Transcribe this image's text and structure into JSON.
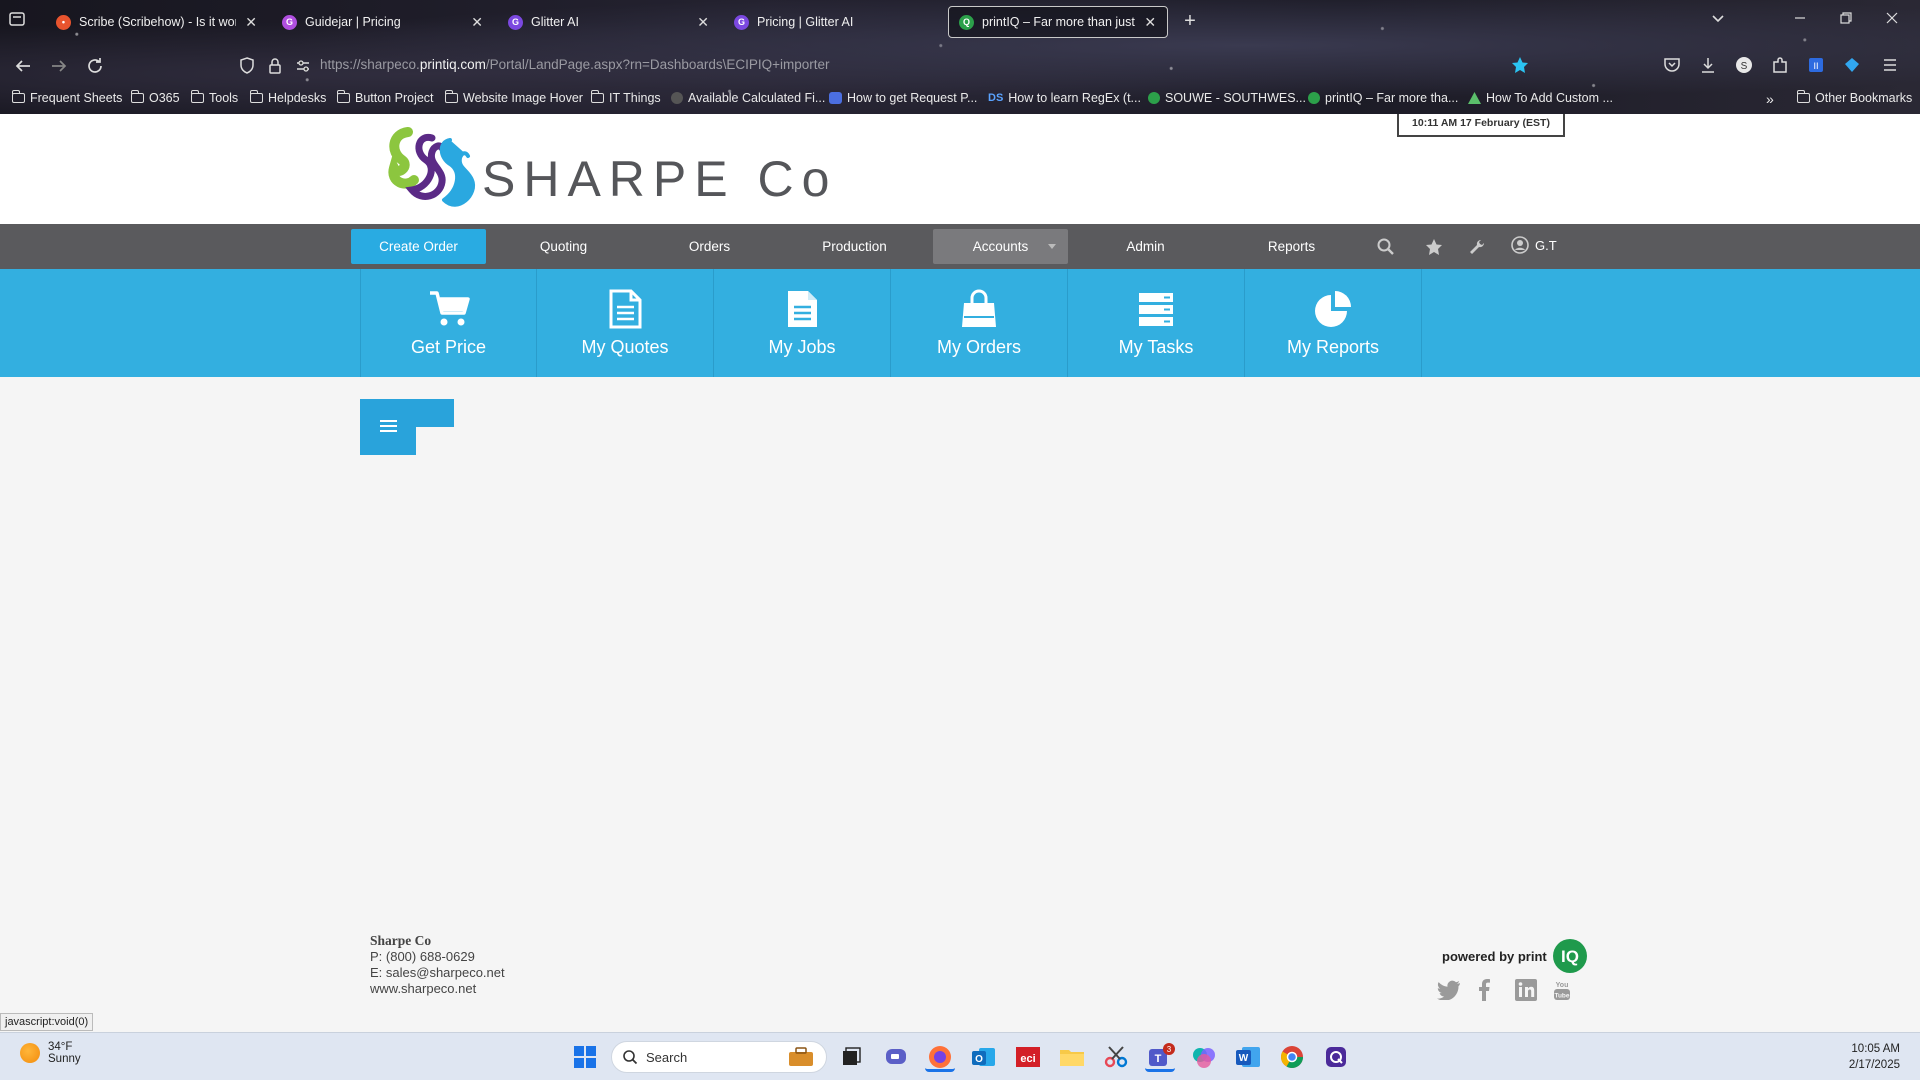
{
  "browser": {
    "tabs": [
      {
        "title": "Scribe (Scribehow) - Is it worth",
        "close": "✕",
        "icon_color": "#e8542e"
      },
      {
        "title": "Guidejar | Pricing",
        "close": "✕",
        "icon_color": "#b04fe0"
      },
      {
        "title": "Glitter AI",
        "close": "✕",
        "icon_color": "#8a4fe6"
      },
      {
        "title": "Pricing | Glitter AI",
        "close": "",
        "icon_color": "#8a4fe6"
      },
      {
        "title": "printIQ – Far more than just an",
        "close": "✕",
        "icon_color": "#2ca04a"
      }
    ],
    "new_tab": "+",
    "url": {
      "prefix": "https://sharpeco.",
      "host": "printiq.com",
      "path": "/Portal/LandPage.aspx?rn=Dashboards\\ECIPIQ+importer"
    },
    "bookmarks": [
      {
        "label": "Frequent Sheets",
        "icon": "folder-icon"
      },
      {
        "label": "O365",
        "icon": "folder-icon"
      },
      {
        "label": "Tools",
        "icon": "folder-icon"
      },
      {
        "label": "Helpdesks",
        "icon": "folder-icon"
      },
      {
        "label": "Button Project",
        "icon": "folder-icon"
      },
      {
        "label": "Website Image Hover",
        "icon": "folder-icon"
      },
      {
        "label": "IT Things",
        "icon": "folder-icon"
      },
      {
        "label": "Available Calculated Fi...",
        "icon": "globe-icon"
      },
      {
        "label": "How to get Request P...",
        "icon": "people-icon"
      },
      {
        "label": "How to learn RegEx (t...",
        "icon": "ds-icon"
      },
      {
        "label": "SOUWE - SOUTHWES...",
        "icon": "printiq-icon"
      },
      {
        "label": "printIQ – Far more tha...",
        "icon": "printiq-icon"
      },
      {
        "label": "How To Add Custom ...",
        "icon": "triangle-icon"
      }
    ],
    "other_bookmarks": "Other Bookmarks",
    "status_link": "javascript:void(0)"
  },
  "site": {
    "brand": "SHARPE Co",
    "clock": "10:11 AM  17 February (EST)",
    "nav": [
      {
        "label": "Create Order"
      },
      {
        "label": "Quoting"
      },
      {
        "label": "Orders"
      },
      {
        "label": "Production"
      },
      {
        "label": "Accounts"
      },
      {
        "label": "Admin"
      },
      {
        "label": "Reports"
      }
    ],
    "user": "G.T",
    "tiles": [
      {
        "label": "Get Price",
        "icon": "cart-icon"
      },
      {
        "label": "My Quotes",
        "icon": "document-icon"
      },
      {
        "label": "My Jobs",
        "icon": "document-icon"
      },
      {
        "label": "My Orders",
        "icon": "shopping-bag-icon"
      },
      {
        "label": "My Tasks",
        "icon": "tasks-icon"
      },
      {
        "label": "My Reports",
        "icon": "pie-chart-icon"
      }
    ],
    "footer": {
      "company": "Sharpe Co",
      "phone": "P: (800) 688-0629",
      "email": "E: sales@sharpeco.net",
      "website": "www.sharpeco.net",
      "powered_by": "powered by print",
      "powered_logo": "IQ"
    }
  },
  "taskbar": {
    "weather_temp": "34°F",
    "weather_desc": "Sunny",
    "search_placeholder": "Search",
    "time": "10:05 AM",
    "date": "2/17/2025",
    "teams_badge": "3"
  }
}
